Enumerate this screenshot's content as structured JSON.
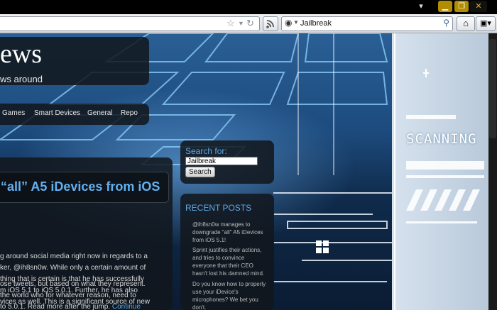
{
  "browser": {
    "search_query": "Jailbreak"
  },
  "site": {
    "title": "ews",
    "tagline": "ws around",
    "nav": [
      "Games",
      "Smart Devices",
      "General",
      "Repo"
    ]
  },
  "sidebar": {
    "search_label": "Search for:",
    "search_value": "Jailbreak",
    "search_button": "Search",
    "recent_title": "RECENT POSTS",
    "recent_posts": [
      "@ih8sn0w manages to downgrade \"all\" A5 iDevices from iOS 5.1!",
      "Sprint justifies their actions, and tries to convince everyone that their CEO hasn't lost his damned mind.",
      "Do you know how to properly use your iDevice's microphones? We bet you don't."
    ]
  },
  "post": {
    "title": "“all” A5 iDevices from iOS",
    "body_lines": [
      "g around social media right now in regards to a",
      "ker, @ih8sn0w. While only a certain amount of",
      "thing that is certain is that he has successfully",
      "m iOS 5.1 to iOS 5.0.1. Further, he has also",
      "vices as well. This is a significant source of new",
      "ose tweets, but based on what they represent.",
      "the world who for whatever reason, need to",
      "to 5.0.1.  Read more after the jump."
    ],
    "continue_label": "Continue"
  },
  "background": {
    "scanning_text": "SCANNING"
  },
  "colors": {
    "link_blue": "#5fa8e6",
    "title_blue": "#63b0ef",
    "win_min": "#b38d00",
    "win_max": "#b38d00"
  }
}
